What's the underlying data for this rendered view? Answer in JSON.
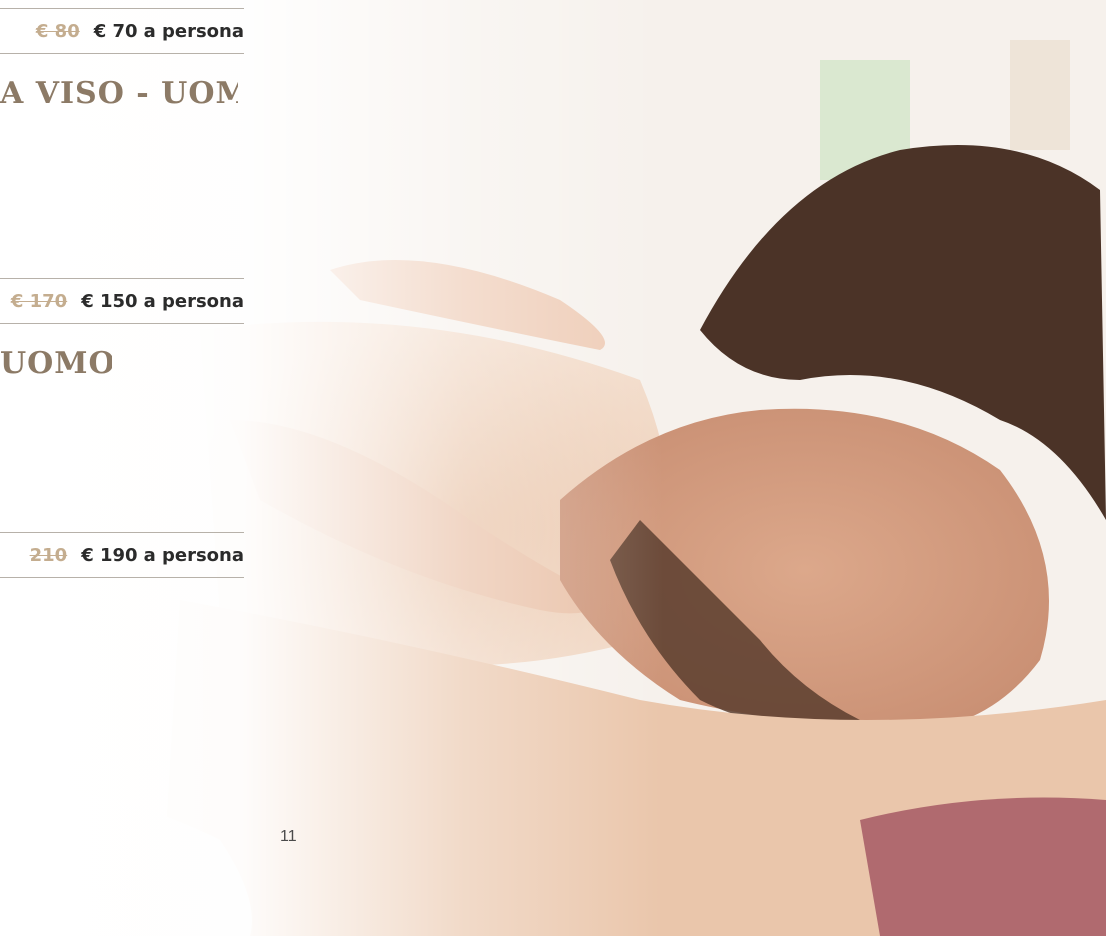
{
  "offers": [
    {
      "old_price": "€ 80",
      "new_price": "€ 70",
      "suffix": "a persona"
    },
    {
      "old_price": "€ 170",
      "new_price": "€ 150",
      "suffix": "a persona"
    },
    {
      "old_price": "210",
      "new_price": "€ 190",
      "suffix": "a persona"
    }
  ],
  "titles": [
    {
      "text": "A VISO - UOMO"
    },
    {
      "text": "UOMO"
    }
  ],
  "page_number": "11",
  "photo": {
    "subject": "man-receiving-back-massage-photo"
  },
  "colors": {
    "old_price": "#c4ad8f",
    "new_price": "#2b2b2b",
    "title": "#8c7a66",
    "rule": "#b7b1a9"
  }
}
